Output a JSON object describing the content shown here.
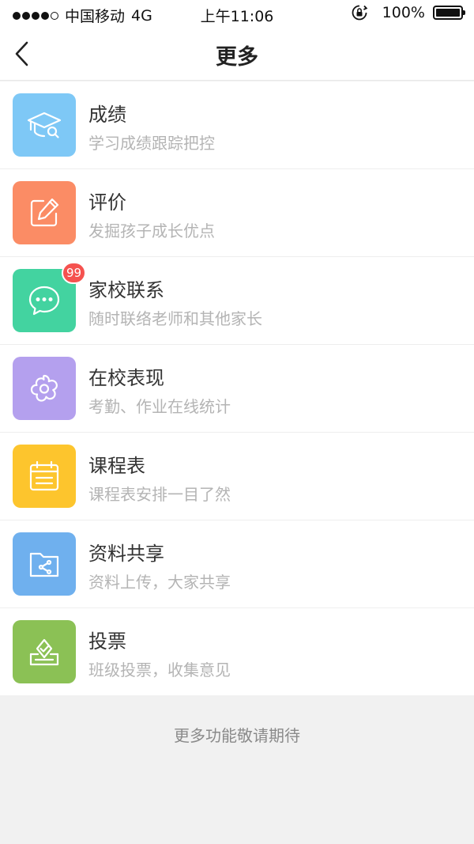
{
  "status_bar": {
    "carrier": "中国移动",
    "network": "4G",
    "time": "上午11:06",
    "battery": "100%"
  },
  "nav": {
    "title": "更多"
  },
  "items": [
    {
      "title": "成绩",
      "desc": "学习成绩跟踪把控",
      "color": "#7ec8f6",
      "icon": "graduation-cap-icon"
    },
    {
      "title": "评价",
      "desc": "发掘孩子成长优点",
      "color": "#fb8c65",
      "icon": "edit-note-icon"
    },
    {
      "title": "家校联系",
      "desc": "随时联络老师和其他家长",
      "color": "#43d3a0",
      "icon": "chat-bubble-icon",
      "badge": "99"
    },
    {
      "title": "在校表现",
      "desc": "考勤、作业在线统计",
      "color": "#b4a0ee",
      "icon": "flower-icon"
    },
    {
      "title": "课程表",
      "desc": "课程表安排一目了然",
      "color": "#fdc52d",
      "icon": "calendar-icon"
    },
    {
      "title": "资料共享",
      "desc": "资料上传，大家共享",
      "color": "#6fb0ee",
      "icon": "shared-folder-icon"
    },
    {
      "title": "投票",
      "desc": "班级投票，收集意见",
      "color": "#8bc155",
      "icon": "ballot-box-icon"
    }
  ],
  "footer": {
    "note": "更多功能敬请期待"
  }
}
